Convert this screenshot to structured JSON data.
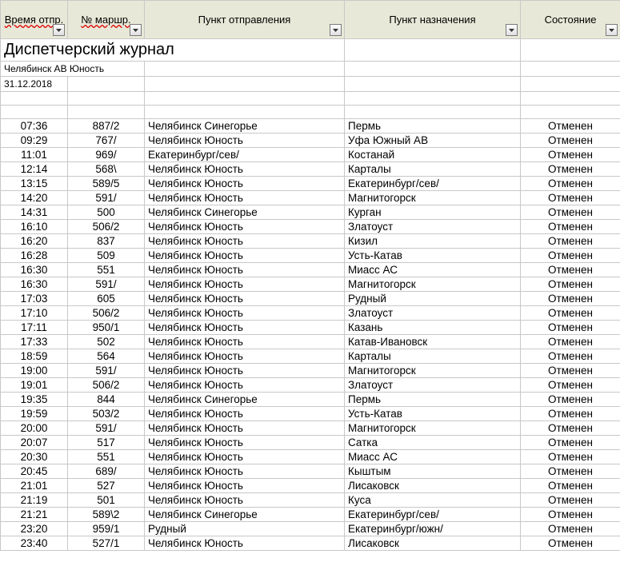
{
  "header": {
    "title": "Диспетчерский журнал",
    "station": "Челябинск АВ Юность",
    "date": "31.12.2018"
  },
  "columns": {
    "time": "Время отпр.",
    "route": "№ маршр.",
    "dep": "Пункт отправления",
    "dest": "Пункт назначения",
    "stat": "Состояние"
  },
  "rows": [
    {
      "time": "07:36",
      "route": "887/2",
      "dep": "Челябинск Синегорье",
      "dest": "Пермь",
      "stat": "Отменен"
    },
    {
      "time": "09:29",
      "route": "767/",
      "dep": "Челябинск Юность",
      "dest": "Уфа Южный АВ",
      "stat": "Отменен"
    },
    {
      "time": "11:01",
      "route": "969/",
      "dep": "Екатеринбург/сев/",
      "dest": "Костанай",
      "stat": "Отменен"
    },
    {
      "time": "12:14",
      "route": "568\\",
      "dep": "Челябинск Юность",
      "dest": "Карталы",
      "stat": "Отменен"
    },
    {
      "time": "13:15",
      "route": "589/5",
      "dep": "Челябинск Юность",
      "dest": "Екатеринбург/сев/",
      "stat": "Отменен"
    },
    {
      "time": "14:20",
      "route": "591/",
      "dep": "Челябинск Юность",
      "dest": "Магнитогорск",
      "stat": "Отменен"
    },
    {
      "time": "14:31",
      "route": "500",
      "dep": "Челябинск Синегорье",
      "dest": "Курган",
      "stat": "Отменен"
    },
    {
      "time": "16:10",
      "route": "506/2",
      "dep": "Челябинск Юность",
      "dest": "Златоуст",
      "stat": "Отменен"
    },
    {
      "time": "16:20",
      "route": "837",
      "dep": "Челябинск Юность",
      "dest": "Кизил",
      "stat": "Отменен"
    },
    {
      "time": "16:28",
      "route": "509",
      "dep": "Челябинск Юность",
      "dest": "Усть-Катав",
      "stat": "Отменен"
    },
    {
      "time": "16:30",
      "route": "551",
      "dep": "Челябинск Юность",
      "dest": "Миасс АС",
      "stat": "Отменен"
    },
    {
      "time": "16:30",
      "route": "591/",
      "dep": "Челябинск Юность",
      "dest": "Магнитогорск",
      "stat": "Отменен"
    },
    {
      "time": "17:03",
      "route": "605",
      "dep": "Челябинск Юность",
      "dest": "Рудный",
      "stat": "Отменен"
    },
    {
      "time": "17:10",
      "route": "506/2",
      "dep": "Челябинск Юность",
      "dest": "Златоуст",
      "stat": "Отменен"
    },
    {
      "time": "17:11",
      "route": "950/1",
      "dep": "Челябинск Юность",
      "dest": "Казань",
      "stat": "Отменен"
    },
    {
      "time": "17:33",
      "route": "502",
      "dep": "Челябинск Юность",
      "dest": "Катав-Ивановск",
      "stat": "Отменен"
    },
    {
      "time": "18:59",
      "route": "564",
      "dep": "Челябинск Юность",
      "dest": "Карталы",
      "stat": "Отменен"
    },
    {
      "time": "19:00",
      "route": "591/",
      "dep": "Челябинск Юность",
      "dest": "Магнитогорск",
      "stat": "Отменен"
    },
    {
      "time": "19:01",
      "route": "506/2",
      "dep": "Челябинск Юность",
      "dest": "Златоуст",
      "stat": "Отменен"
    },
    {
      "time": "19:35",
      "route": "844",
      "dep": "Челябинск Синегорье",
      "dest": "Пермь",
      "stat": "Отменен"
    },
    {
      "time": "19:59",
      "route": "503/2",
      "dep": "Челябинск Юность",
      "dest": "Усть-Катав",
      "stat": "Отменен"
    },
    {
      "time": "20:00",
      "route": "591/",
      "dep": "Челябинск Юность",
      "dest": "Магнитогорск",
      "stat": "Отменен"
    },
    {
      "time": "20:07",
      "route": "517",
      "dep": "Челябинск Юность",
      "dest": "Сатка",
      "stat": "Отменен"
    },
    {
      "time": "20:30",
      "route": "551",
      "dep": "Челябинск Юность",
      "dest": "Миасс АС",
      "stat": "Отменен"
    },
    {
      "time": "20:45",
      "route": "689/",
      "dep": "Челябинск Юность",
      "dest": "Кыштым",
      "stat": "Отменен"
    },
    {
      "time": "21:01",
      "route": "527",
      "dep": "Челябинск Юность",
      "dest": "Лисаковск",
      "stat": "Отменен"
    },
    {
      "time": "21:19",
      "route": "501",
      "dep": "Челябинск Юность",
      "dest": "Куса",
      "stat": "Отменен"
    },
    {
      "time": "21:21",
      "route": "589\\2",
      "dep": "Челябинск Синегорье",
      "dest": "Екатеринбург/сев/",
      "stat": "Отменен"
    },
    {
      "time": "23:20",
      "route": "959/1",
      "dep": "Рудный",
      "dest": "Екатеринбург/южн/",
      "stat": "Отменен"
    },
    {
      "time": "23:40",
      "route": "527/1",
      "dep": "Челябинск Юность",
      "dest": "Лисаковск",
      "stat": "Отменен"
    }
  ]
}
